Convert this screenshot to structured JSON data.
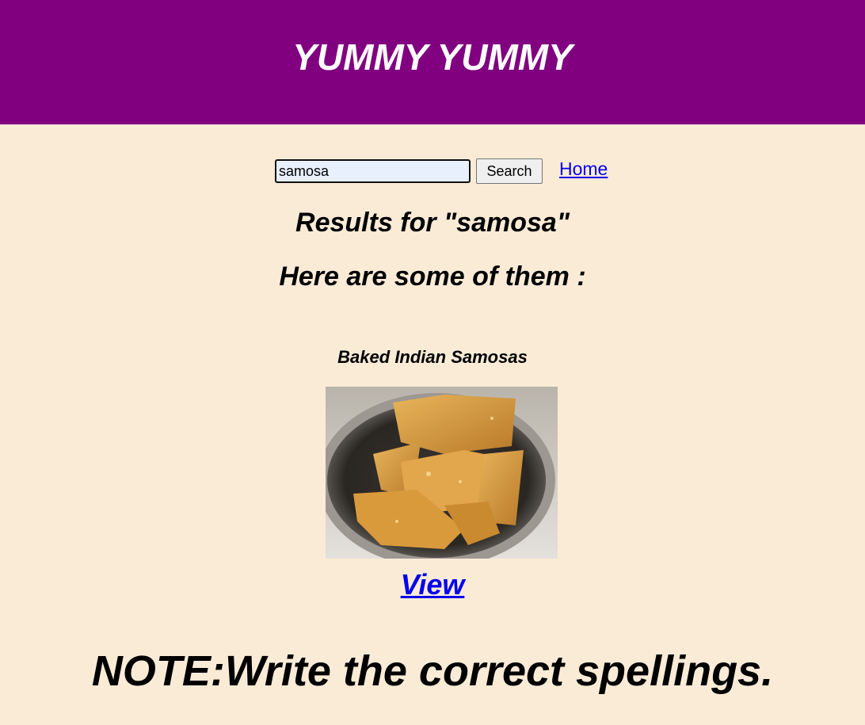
{
  "header": {
    "title": "YUMMY YUMMY",
    "background_color": "#800080"
  },
  "search": {
    "value": "samosa",
    "button_label": "Search"
  },
  "nav": {
    "home_label": "Home"
  },
  "results": {
    "heading": "Results for \"samosa\"",
    "subheading": "Here are some of them :"
  },
  "recipe": {
    "title": "Baked Indian Samosas",
    "image_icon": "samosa-photo",
    "view_label": "View"
  },
  "note": "NOTE:Write the correct spellings.",
  "colors": {
    "page_background": "#faebd7",
    "link": "#0000ee"
  }
}
